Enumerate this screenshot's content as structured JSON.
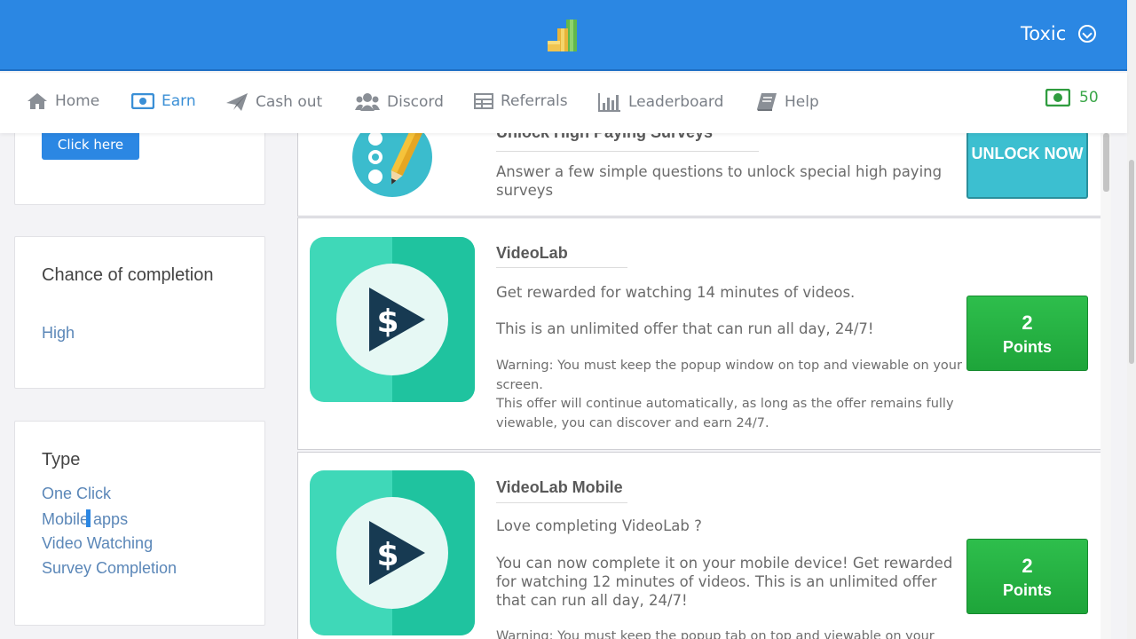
{
  "header": {
    "username": "Toxic"
  },
  "nav": {
    "items": [
      {
        "label": "Home",
        "icon": "home-icon"
      },
      {
        "label": "Earn",
        "icon": "money-icon",
        "active": true
      },
      {
        "label": "Cash out",
        "icon": "paper-plane-icon"
      },
      {
        "label": "Discord",
        "icon": "users-icon"
      },
      {
        "label": "Referrals",
        "icon": "table-icon"
      },
      {
        "label": "Leaderboard",
        "icon": "bar-chart-icon"
      },
      {
        "label": "Help",
        "icon": "book-icon"
      }
    ],
    "balance": "50"
  },
  "sidebar": {
    "click_button": "Click here",
    "chance": {
      "title": "Chance of completion",
      "value": "High"
    },
    "type": {
      "title": "Type",
      "options": [
        "One Click",
        "Mobile apps",
        "Video Watching",
        "Survey Completion"
      ]
    }
  },
  "offers": [
    {
      "title": "Unlock High Paying Surveys",
      "description": "Answer a few simple questions to unlock special high paying surveys",
      "button": "UNLOCK NOW"
    },
    {
      "title": "VideoLab",
      "line1": "Get rewarded for watching 14 minutes of videos.",
      "line2": "This is an unlimited offer that can run all day, 24/7!",
      "warning": "Warning: You must keep the popup window on top and viewable on your screen.",
      "note": "This offer will continue automatically, as long as the offer remains fully viewable, you can discover and earn 24/7.",
      "points": "2",
      "points_label": "Points"
    },
    {
      "title": "VideoLab Mobile",
      "line1": "Love completing VideoLab ?",
      "line2": "You can now complete it on your mobile device! Get rewarded for watching 12 minutes of videos. This is an unlimited offer that can run all day, 24/7!",
      "warning": "Warning: You must keep the popup tab on top and viewable on your",
      "points": "2",
      "points_label": "Points"
    }
  ],
  "colors": {
    "header": "#2b87e3",
    "accent_green": "#24b044",
    "teal": "#3fd8b8"
  }
}
